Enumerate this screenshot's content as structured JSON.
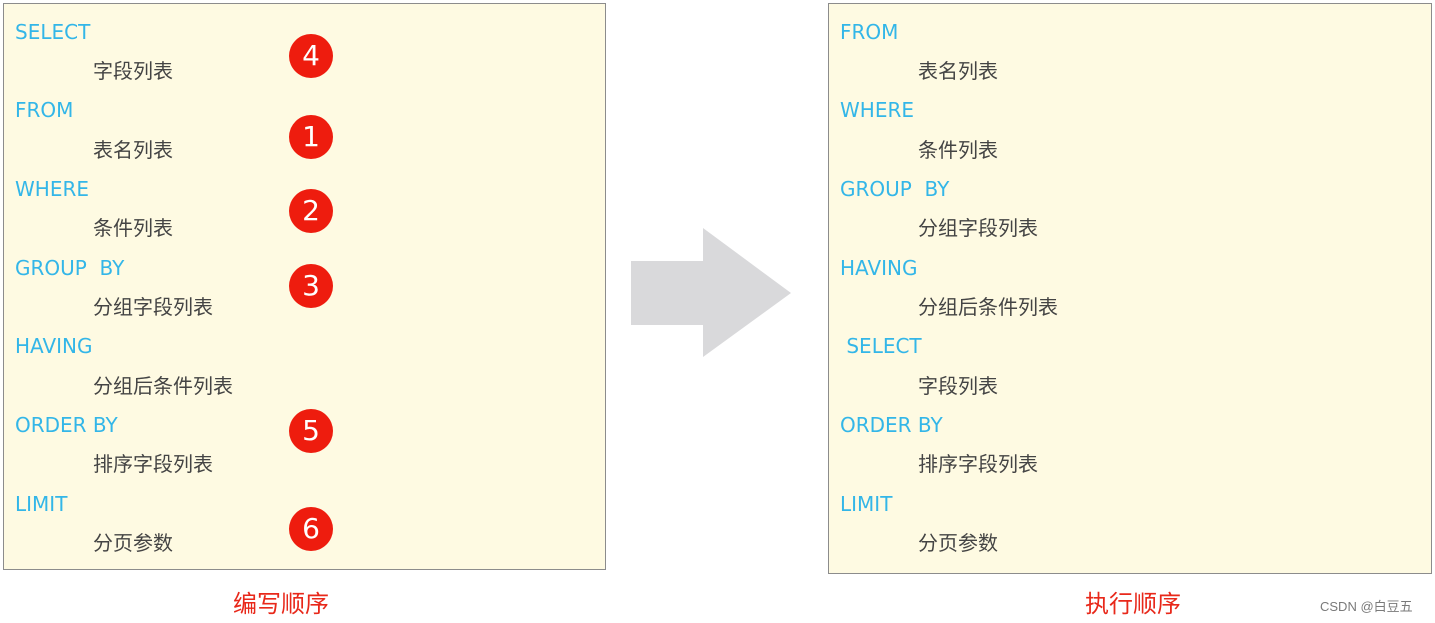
{
  "writing_order": {
    "caption": "编写顺序",
    "lines": [
      {
        "keyword": "SELECT",
        "arg": "字段列表",
        "step": "4"
      },
      {
        "keyword": "FROM",
        "arg": "表名列表",
        "step": "1"
      },
      {
        "keyword": "WHERE",
        "arg": "条件列表",
        "step": "2"
      },
      {
        "keyword": "GROUP  BY",
        "arg": "分组字段列表",
        "step": "3"
      },
      {
        "keyword": "HAVING",
        "arg": "分组后条件列表",
        "step": ""
      },
      {
        "keyword": "ORDER BY",
        "arg": "排序字段列表",
        "step": "5"
      },
      {
        "keyword": "LIMIT",
        "arg": "分页参数",
        "step": "6"
      }
    ]
  },
  "execution_order": {
    "caption": "执行顺序",
    "lines": [
      {
        "keyword": "FROM",
        "arg": "表名列表"
      },
      {
        "keyword": "WHERE",
        "arg": "条件列表"
      },
      {
        "keyword": "GROUP  BY",
        "arg": "分组字段列表"
      },
      {
        "keyword": "HAVING",
        "arg": "分组后条件列表"
      },
      {
        "keyword": " SELECT",
        "arg": "字段列表"
      },
      {
        "keyword": "ORDER BY",
        "arg": "排序字段列表"
      },
      {
        "keyword": "LIMIT",
        "arg": "分页参数"
      }
    ]
  },
  "arrow": {
    "icon": "right-arrow-icon",
    "color": "#d9d9db"
  },
  "colors": {
    "keyword": "#33b6e8",
    "badge": "#ee1c0e",
    "caption": "#e8281a",
    "box_bg": "#fefae2"
  },
  "watermark": "CSDN @白豆五"
}
